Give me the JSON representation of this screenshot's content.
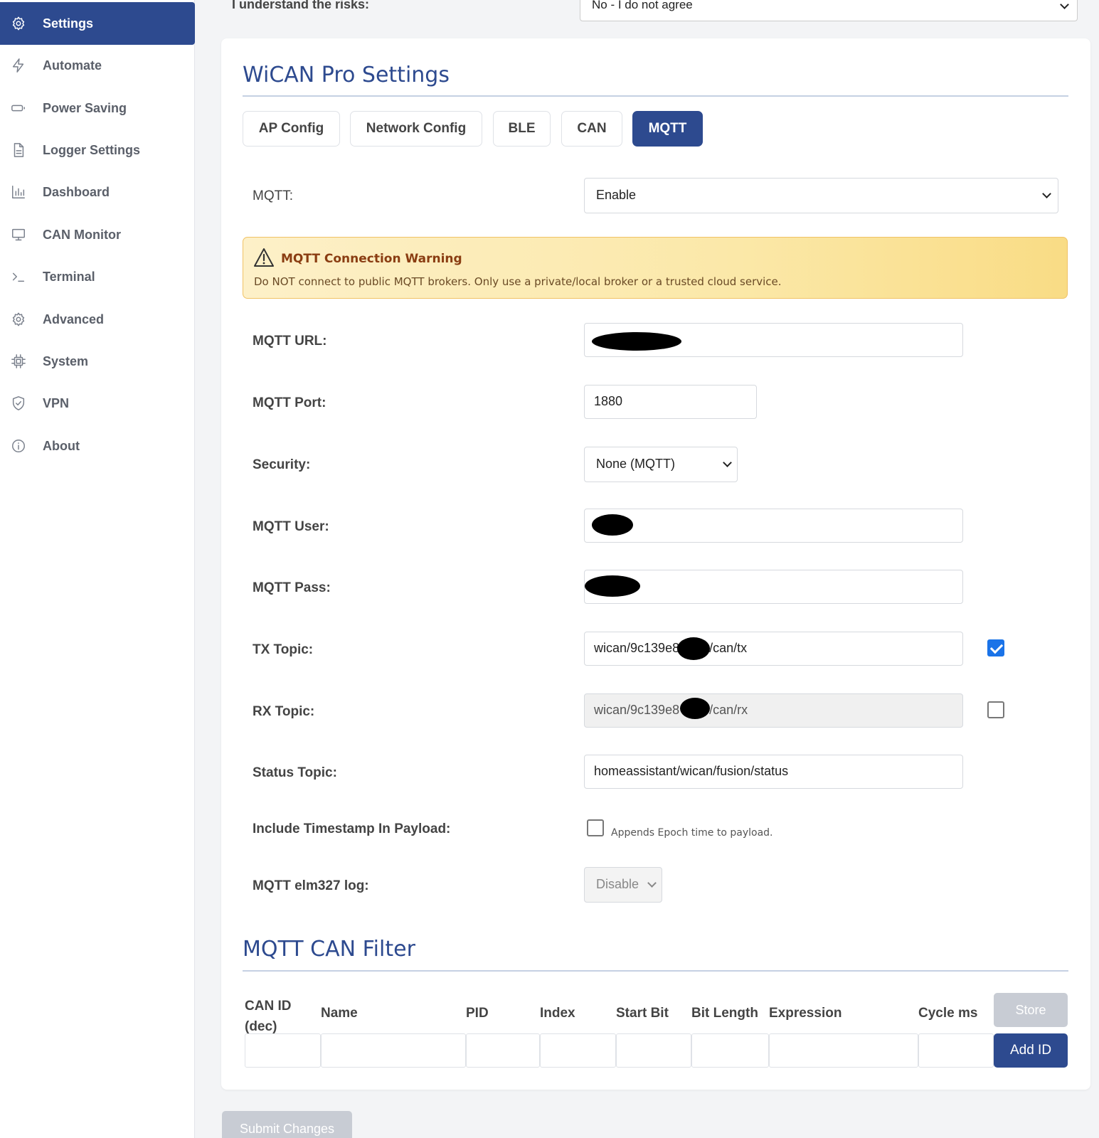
{
  "sidebar": {
    "items": [
      {
        "label": "Settings",
        "icon": "gear-icon",
        "active": true
      },
      {
        "label": "Automate",
        "icon": "bolt-icon"
      },
      {
        "label": "Power Saving",
        "icon": "battery-icon"
      },
      {
        "label": "Logger Settings",
        "icon": "document-icon"
      },
      {
        "label": "Dashboard",
        "icon": "bar-chart-icon"
      },
      {
        "label": "CAN Monitor",
        "icon": "monitor-icon"
      },
      {
        "label": "Terminal",
        "icon": "terminal-icon"
      },
      {
        "label": "Advanced",
        "icon": "gear-icon"
      },
      {
        "label": "System",
        "icon": "chip-icon"
      },
      {
        "label": "VPN",
        "icon": "shield-icon"
      },
      {
        "label": "About",
        "icon": "info-icon"
      }
    ]
  },
  "risk": {
    "label": "I understand the risks:",
    "value": "No - I do not agree"
  },
  "settings": {
    "title": "WiCAN Pro Settings",
    "tabs": [
      "AP Config",
      "Network Config",
      "BLE",
      "CAN",
      "MQTT"
    ],
    "active_tab": "MQTT"
  },
  "mqtt": {
    "enable_label": "MQTT:",
    "enable_value": "Enable",
    "warning_title": "MQTT Connection Warning",
    "warning_text": "Do NOT connect to public MQTT brokers. Only use a private/local broker or a trusted cloud service.",
    "url_label": "MQTT URL:",
    "port_label": "MQTT Port:",
    "port_value": "1880",
    "security_label": "Security:",
    "security_value": "None (MQTT)",
    "user_label": "MQTT User:",
    "pass_label": "MQTT Pass:",
    "tx_label": "TX Topic:",
    "tx_prefix": "wican/9c139e8",
    "tx_suffix": "/can/tx",
    "tx_checked": true,
    "rx_label": "RX Topic:",
    "rx_prefix": "wican/9c139e8",
    "rx_suffix": "/can/rx",
    "rx_checked": false,
    "status_label": "Status Topic:",
    "status_value": "homeassistant/wican/fusion/status",
    "timestamp_label": "Include Timestamp In Payload:",
    "timestamp_checked": false,
    "timestamp_hint": "Appends Epoch time to payload.",
    "elm_label": "MQTT elm327 log:",
    "elm_value": "Disable"
  },
  "filter": {
    "title": "MQTT CAN Filter",
    "columns": [
      "CAN ID\n(dec)",
      "Name",
      "PID",
      "Index",
      "Start Bit",
      "Bit Length",
      "Expression",
      "Cycle ms"
    ],
    "store_label": "Store",
    "add_label": "Add ID"
  },
  "submit_label": "Submit Changes",
  "colors": {
    "primary": "#2d4a8f",
    "warning_bg": "#fbe8a8",
    "checkbox_checked": "#1a73e8"
  }
}
